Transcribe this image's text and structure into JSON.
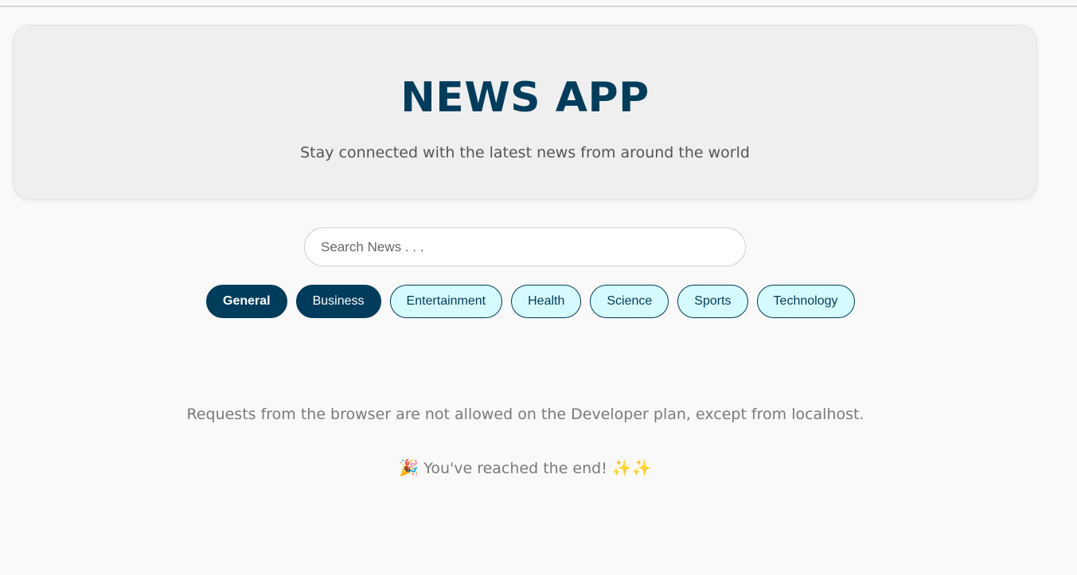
{
  "header": {
    "title": "NEWS APP",
    "subtitle": "Stay connected with the latest news from around the world"
  },
  "search": {
    "placeholder": "Search News . . .",
    "value": ""
  },
  "categories": [
    {
      "label": "General",
      "active": true
    },
    {
      "label": "Business",
      "active": true
    },
    {
      "label": "Entertainment",
      "active": false
    },
    {
      "label": "Health",
      "active": false
    },
    {
      "label": "Science",
      "active": false
    },
    {
      "label": "Sports",
      "active": false
    },
    {
      "label": "Technology",
      "active": false
    }
  ],
  "error_message": "Requests from the browser are not allowed on the Developer plan, except from localhost.",
  "end_message": {
    "prefix_icon": "🎉",
    "text": "You've reached the end!",
    "suffix_icons": "✨✨"
  },
  "colors": {
    "brand": "#003d5c",
    "chip_inactive_bg": "#d6fbff"
  }
}
